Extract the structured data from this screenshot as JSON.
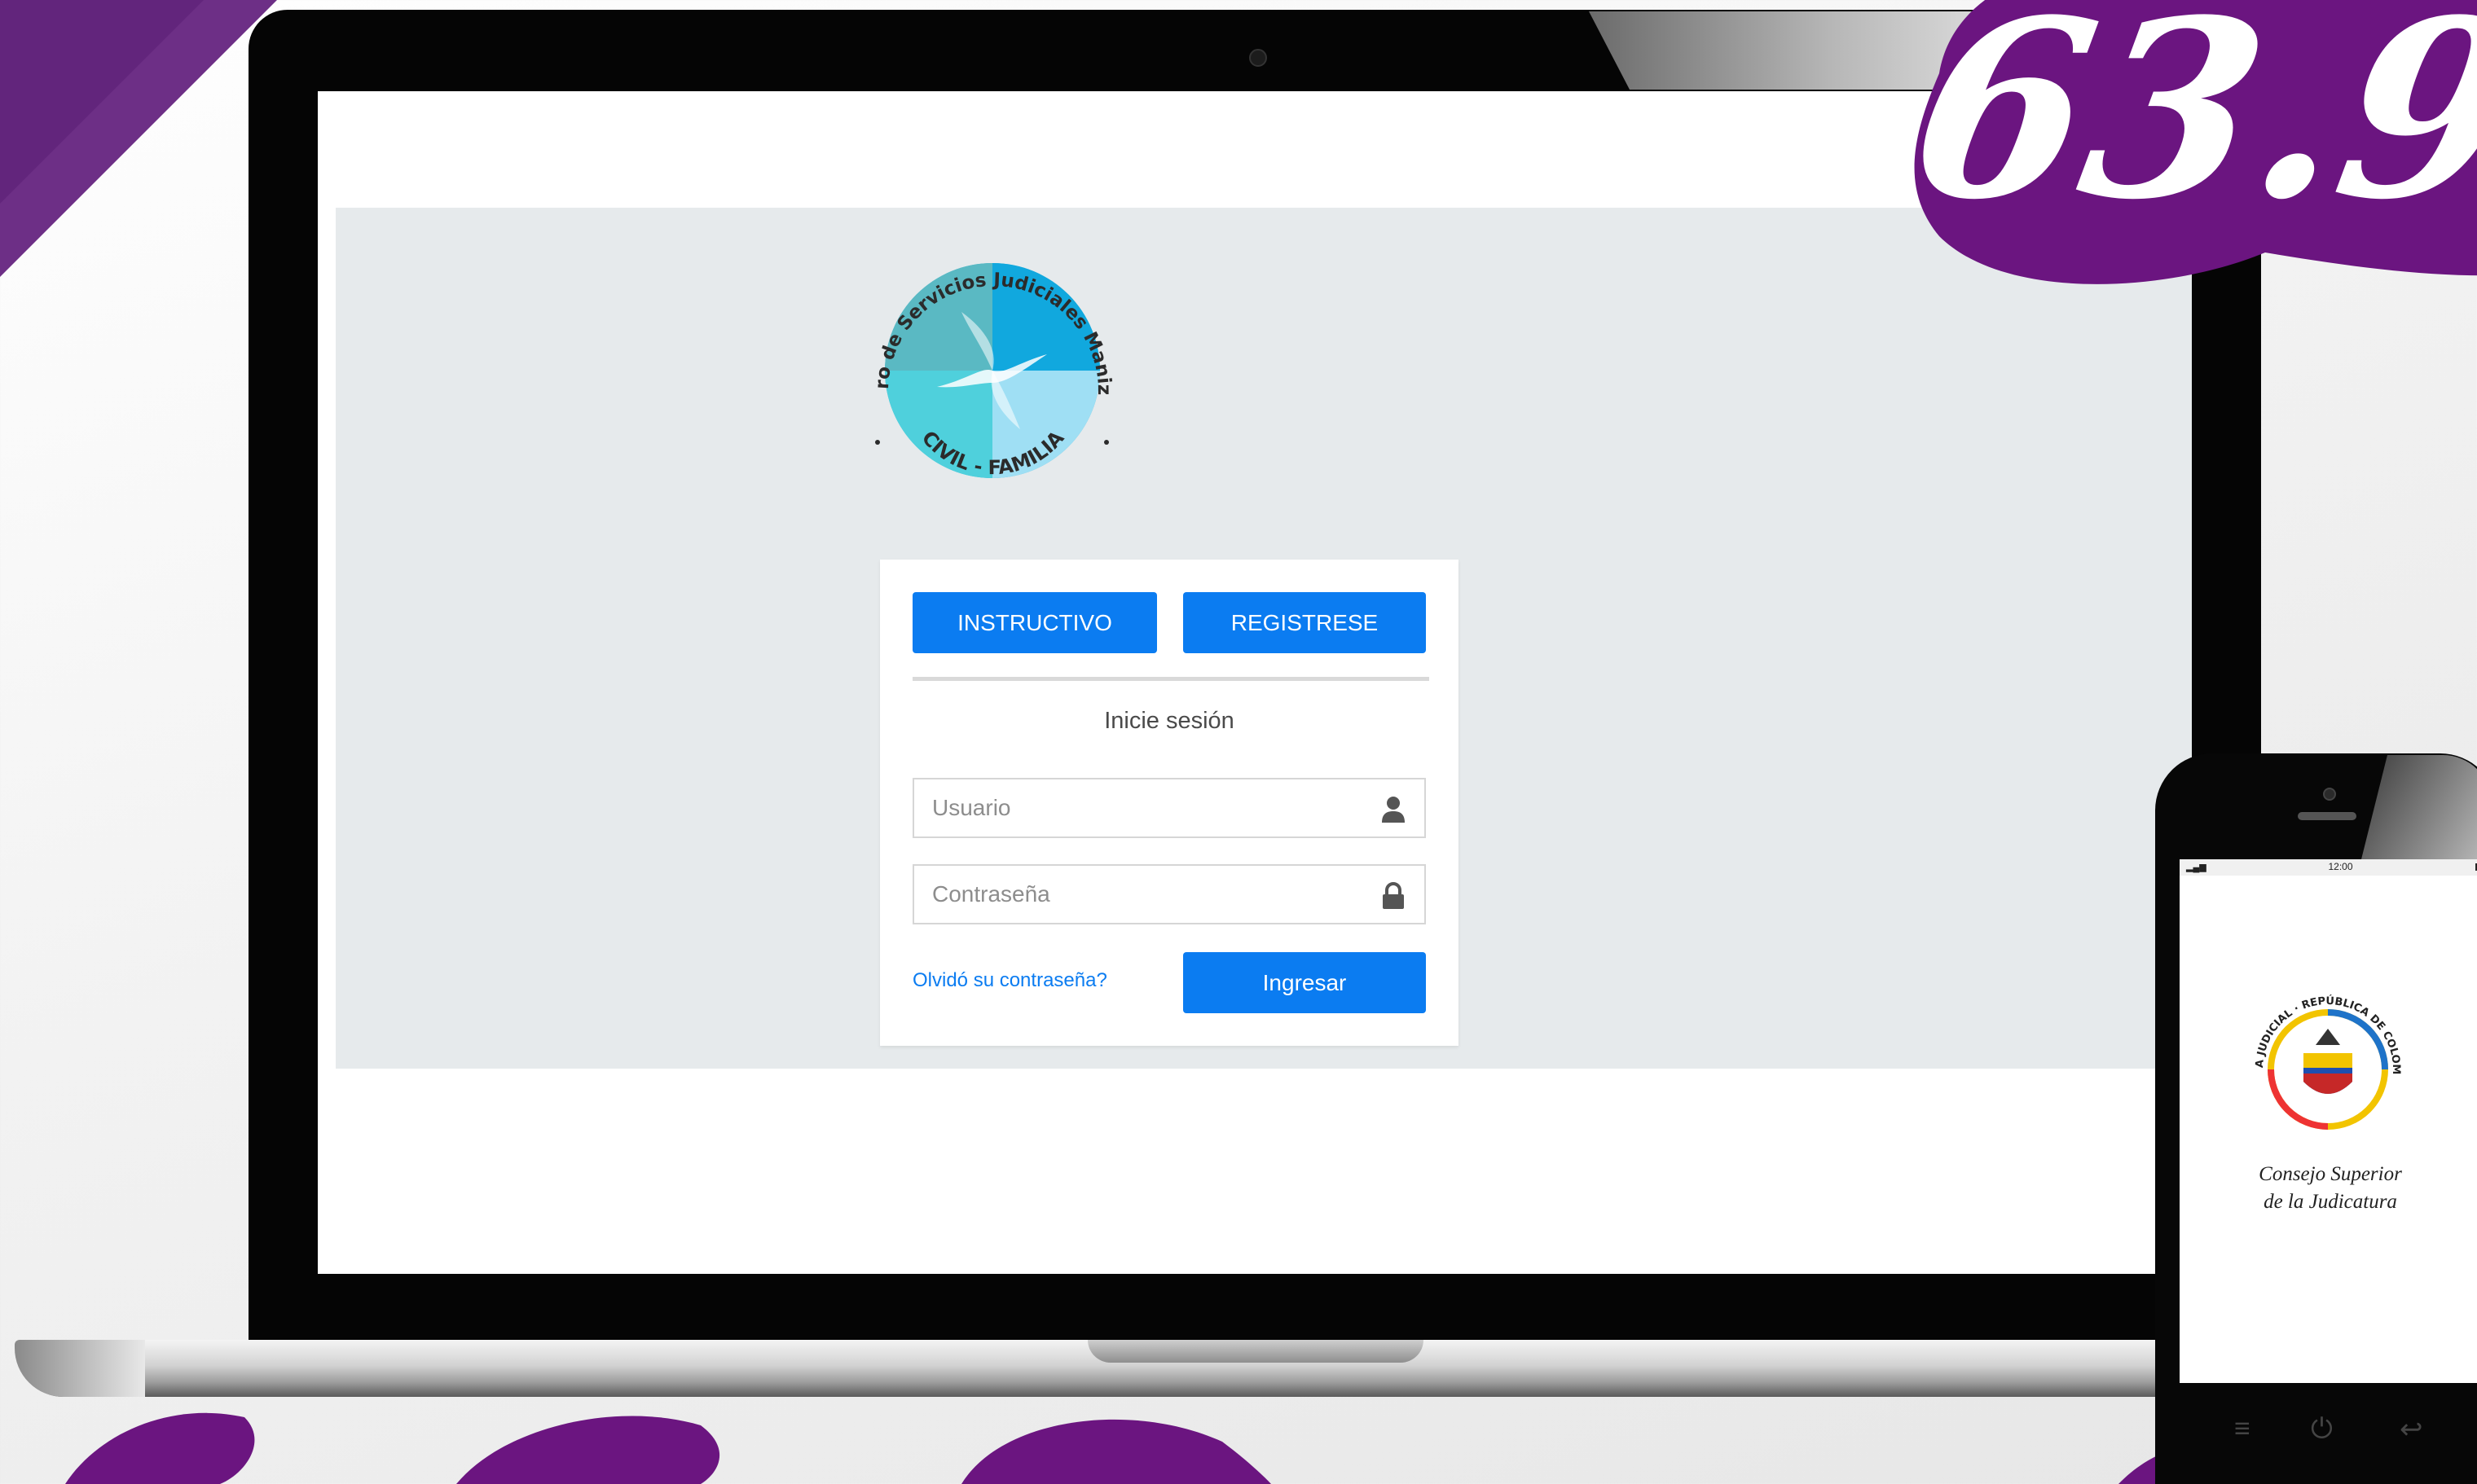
{
  "colors": {
    "brand_purple": "#6b1580",
    "primary_button": "#0b7cf1",
    "app_background": "#e6eaec"
  },
  "promo": {
    "number": "63.9"
  },
  "seal": {
    "top_text": "Centro de Servicios Judiciales Manizales",
    "bottom_text": "CIVIL - FAMILIA"
  },
  "login": {
    "instructivo_label": "INSTRUCTIVO",
    "registrese_label": "REGISTRESE",
    "title": "Inicie sesión",
    "username_placeholder": "Usuario",
    "password_placeholder": "Contraseña",
    "forgot_link": "Olvidó su contraseña?",
    "submit_label": "Ingresar",
    "username_icon": "user-icon",
    "password_icon": "lock-icon"
  },
  "phone": {
    "time": "12:00",
    "crest_text": "RAMA JUDICIAL · REPÚBLICA DE COLOMBIA",
    "org_line1": "Consejo Superior",
    "org_line2": "de la Judicatura",
    "nav_icons": [
      "menu-icon",
      "power-icon",
      "back-icon"
    ]
  }
}
